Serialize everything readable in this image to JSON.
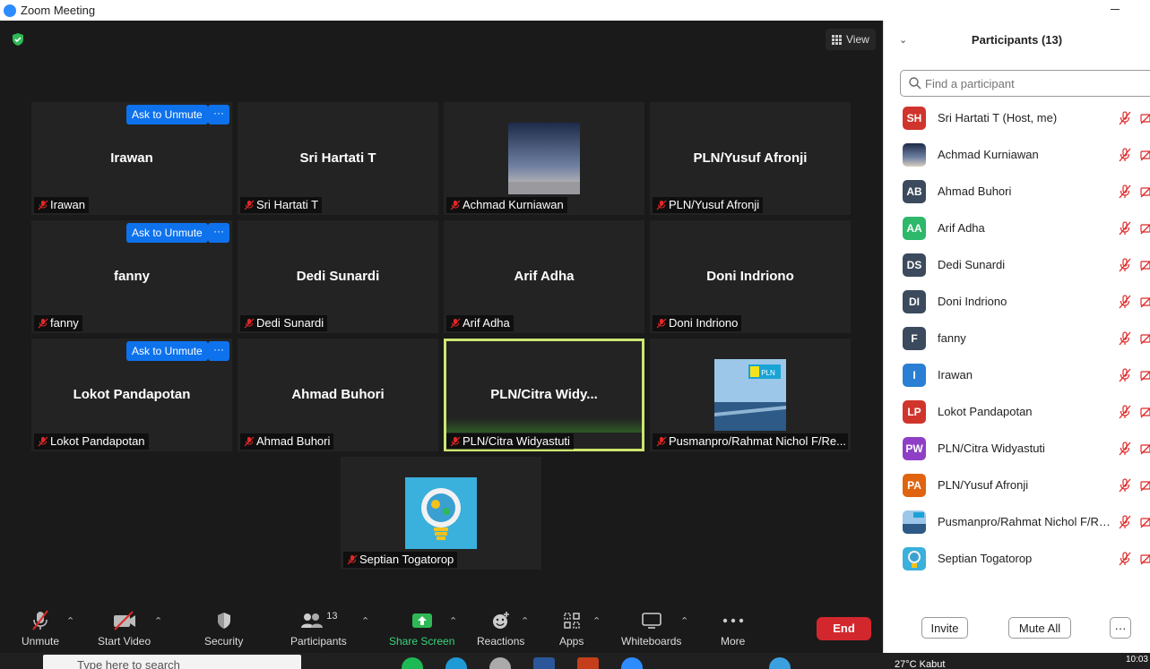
{
  "window": {
    "title": "Zoom Meeting"
  },
  "stage": {
    "view_label": "View"
  },
  "tiles": [
    {
      "name": "Irawan",
      "label": "Irawan",
      "ask": true
    },
    {
      "name": "Sri Hartati T",
      "label": "Sri Hartati T",
      "ask": false
    },
    {
      "name": "",
      "label": "Achmad Kurniawan",
      "ask": false,
      "pic": "sky"
    },
    {
      "name": "PLN/Yusuf Afronji",
      "label": "PLN/Yusuf Afronji",
      "ask": false
    },
    {
      "name": "fanny",
      "label": "fanny",
      "ask": true
    },
    {
      "name": "Dedi Sunardi",
      "label": "Dedi Sunardi",
      "ask": false
    },
    {
      "name": "Arif Adha",
      "label": "Arif Adha",
      "ask": false
    },
    {
      "name": "Doni Indriono",
      "label": "Doni Indriono",
      "ask": false
    },
    {
      "name": "Lokot Pandapotan",
      "label": "Lokot Pandapotan",
      "ask": true
    },
    {
      "name": "Ahmad Buhori",
      "label": "Ahmad Buhori",
      "ask": false
    },
    {
      "name": "PLN/Citra  Widy...",
      "label": "PLN/Citra Widyastuti",
      "ask": false,
      "active": true
    },
    {
      "name": "",
      "label": "Pusmanpro/Rahmat Nichol F/Re...",
      "ask": false,
      "pic": "pln"
    },
    {
      "name": "",
      "label": "Septian Togatorop",
      "ask": false,
      "pic": "bulb"
    }
  ],
  "tile_ask_label": "Ask to Unmute",
  "tile_more_label": "···",
  "toolbar": {
    "unmute": "Unmute",
    "start_video": "Start Video",
    "security": "Security",
    "participants": "Participants",
    "participants_count": "13",
    "share_screen": "Share Screen",
    "reactions": "Reactions",
    "apps": "Apps",
    "whiteboards": "Whiteboards",
    "more": "More",
    "end": "End"
  },
  "panel": {
    "title": "Participants (13)",
    "search_placeholder": "Find a participant",
    "participants": [
      {
        "initials": "SH",
        "name": "Sri Hartati T (Host, me)",
        "color": "#d0342c"
      },
      {
        "initials": "",
        "name": "Achmad Kurniawan",
        "color": "#5a6b88",
        "pic": "sky"
      },
      {
        "initials": "AB",
        "name": "Ahmad Buhori",
        "color": "#3b4a5c"
      },
      {
        "initials": "AA",
        "name": "Arif Adha",
        "color": "#2db86a"
      },
      {
        "initials": "DS",
        "name": "Dedi Sunardi",
        "color": "#3b4a5c"
      },
      {
        "initials": "DI",
        "name": "Doni Indriono",
        "color": "#3b4a5c"
      },
      {
        "initials": "F",
        "name": "fanny",
        "color": "#3b4a5c"
      },
      {
        "initials": "I",
        "name": "Irawan",
        "color": "#2a7fd4"
      },
      {
        "initials": "LP",
        "name": "Lokot Pandapotan",
        "color": "#d0342c"
      },
      {
        "initials": "PW",
        "name": "PLN/Citra Widyastuti",
        "color": "#8f3fc6"
      },
      {
        "initials": "PA",
        "name": "PLN/Yusuf Afronji",
        "color": "#e0640f"
      },
      {
        "initials": "",
        "name": "Pusmanpro/Rahmat Nichol F/Re...",
        "color": "#6ea0cf",
        "pic": "pln"
      },
      {
        "initials": "",
        "name": "Septian Togatorop",
        "color": "#3aa8d8",
        "pic": "bulb"
      }
    ],
    "invite": "Invite",
    "mute_all": "Mute All",
    "more": "···"
  },
  "taskbar": {
    "search_placeholder": "Type here to search",
    "weather": "27°C  Kabut",
    "time": "10:03"
  },
  "colors": {
    "accent": "#0e72ed",
    "end": "#d3272e",
    "share": "#3ad47a",
    "active_border": "#cde671"
  }
}
